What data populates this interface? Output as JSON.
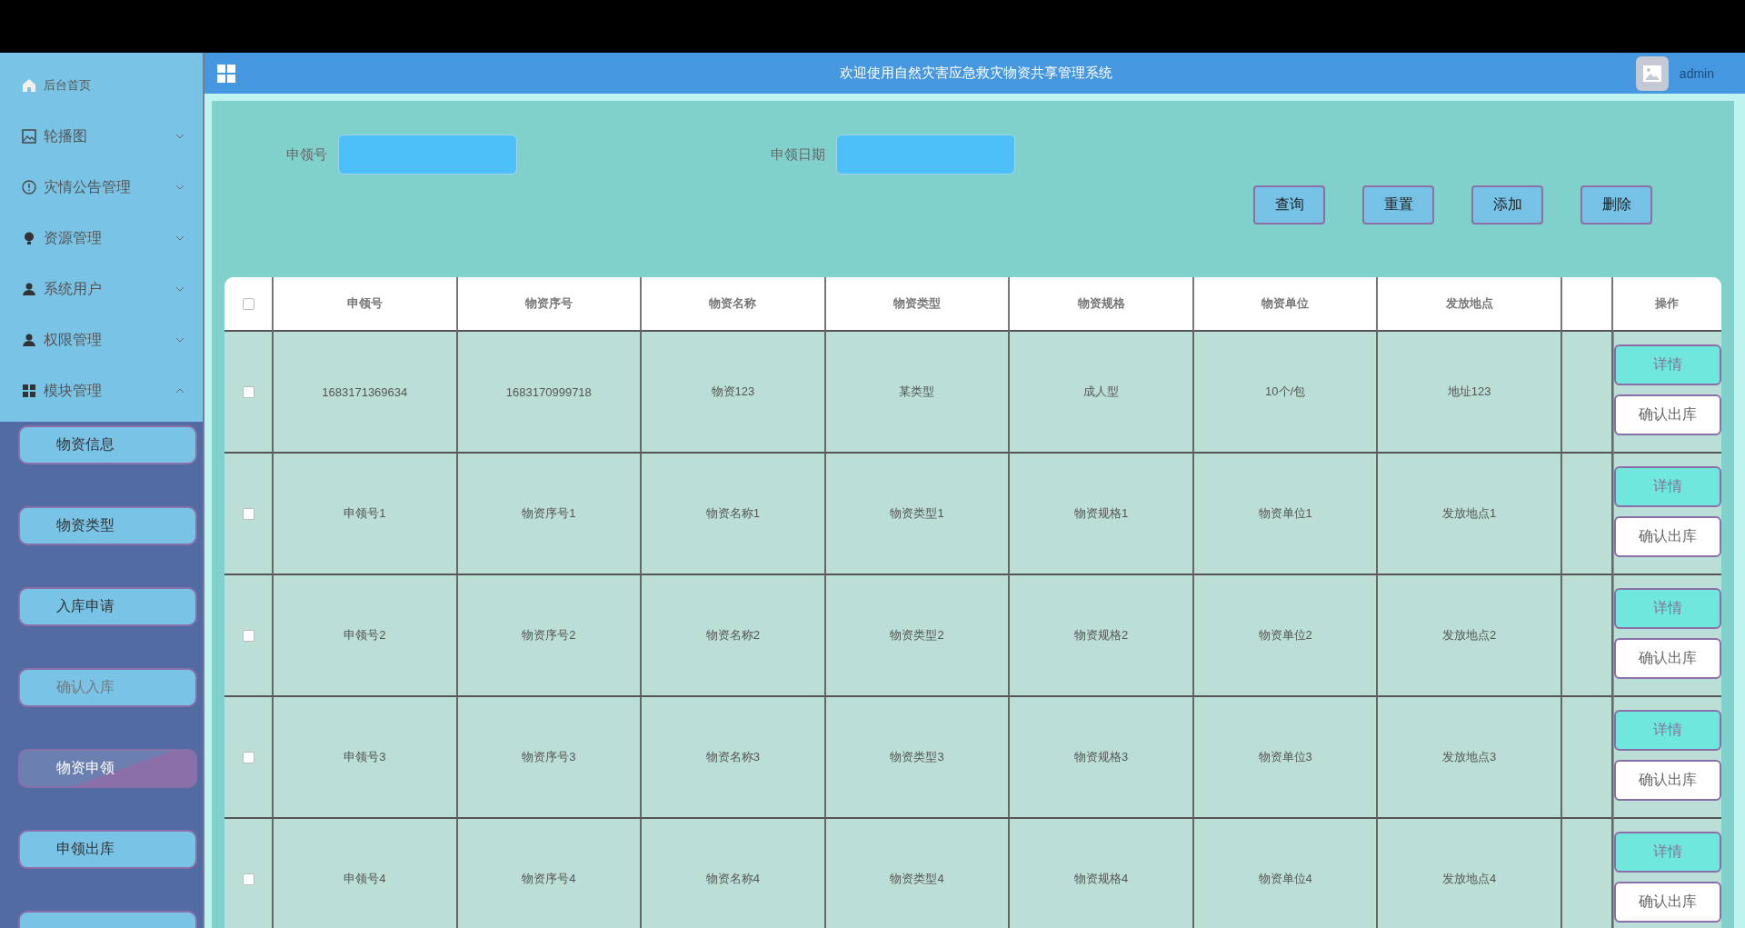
{
  "menu": [
    {
      "kind": "link",
      "label": "后台首页"
    },
    {
      "kind": "group",
      "label": "轮播图",
      "expanded": false
    },
    {
      "kind": "group",
      "label": "灾情公告管理",
      "expanded": false
    },
    {
      "kind": "group",
      "label": "资源管理",
      "expanded": false
    },
    {
      "kind": "group",
      "label": "系统用户",
      "expanded": false
    },
    {
      "kind": "group",
      "label": "权限管理",
      "expanded": false
    },
    {
      "kind": "group",
      "label": "模块管理",
      "expanded": true
    }
  ],
  "submenu": [
    {
      "kind": "item",
      "label": "物资信息",
      "selected": false,
      "muted": false
    },
    {
      "kind": "item",
      "label": "物资类型",
      "selected": false,
      "muted": false
    },
    {
      "kind": "item",
      "label": "入库申请",
      "selected": false,
      "muted": false
    },
    {
      "kind": "item",
      "label": "确认入库",
      "selected": false,
      "muted": true
    },
    {
      "kind": "item",
      "label": "物资申领",
      "selected": true,
      "muted": false
    },
    {
      "kind": "item",
      "label": "申领出库",
      "selected": false,
      "muted": false
    },
    {
      "kind": "cut"
    }
  ],
  "header": {
    "title": "欢迎使用自然灾害应急救灾物资共享管理系统",
    "user": "admin"
  },
  "search": {
    "fields": [
      {
        "label": "申领号"
      },
      {
        "label": "申领日期"
      }
    ],
    "buttons": [
      "查询",
      "重置",
      "添加",
      "删除"
    ]
  },
  "table": {
    "all_checked": false,
    "columns": [
      "申领号",
      "物资序号",
      "物资名称",
      "物资类型",
      "物资规格",
      "物资单位",
      "发放地点",
      "",
      "操作"
    ],
    "rows": [
      {
        "checked": false,
        "cells": [
          "1683171369634",
          "1683170999718",
          "物资123",
          "某类型",
          "成人型",
          "10个/包",
          "地址123"
        ],
        "actions": [
          "详情",
          "确认出库"
        ]
      },
      {
        "checked": false,
        "cells": [
          "申领号1",
          "物资序号1",
          "物资名称1",
          "物资类型1",
          "物资规格1",
          "物资单位1",
          "发放地点1"
        ],
        "actions": [
          "详情",
          "确认出库"
        ]
      },
      {
        "checked": false,
        "cells": [
          "申领号2",
          "物资序号2",
          "物资名称2",
          "物资类型2",
          "物资规格2",
          "物资单位2",
          "发放地点2"
        ],
        "actions": [
          "详情",
          "确认出库"
        ]
      },
      {
        "checked": false,
        "cells": [
          "申领号3",
          "物资序号3",
          "物资名称3",
          "物资类型3",
          "物资规格3",
          "物资单位3",
          "发放地点3"
        ],
        "actions": [
          "详情",
          "确认出库"
        ]
      },
      {
        "checked": false,
        "cells": [
          "申领号4",
          "物资序号4",
          "物资名称4",
          "物资类型4",
          "物资规格4",
          "物资单位4",
          "发放地点4"
        ],
        "actions": [
          "详情",
          "确认出库"
        ]
      }
    ]
  }
}
